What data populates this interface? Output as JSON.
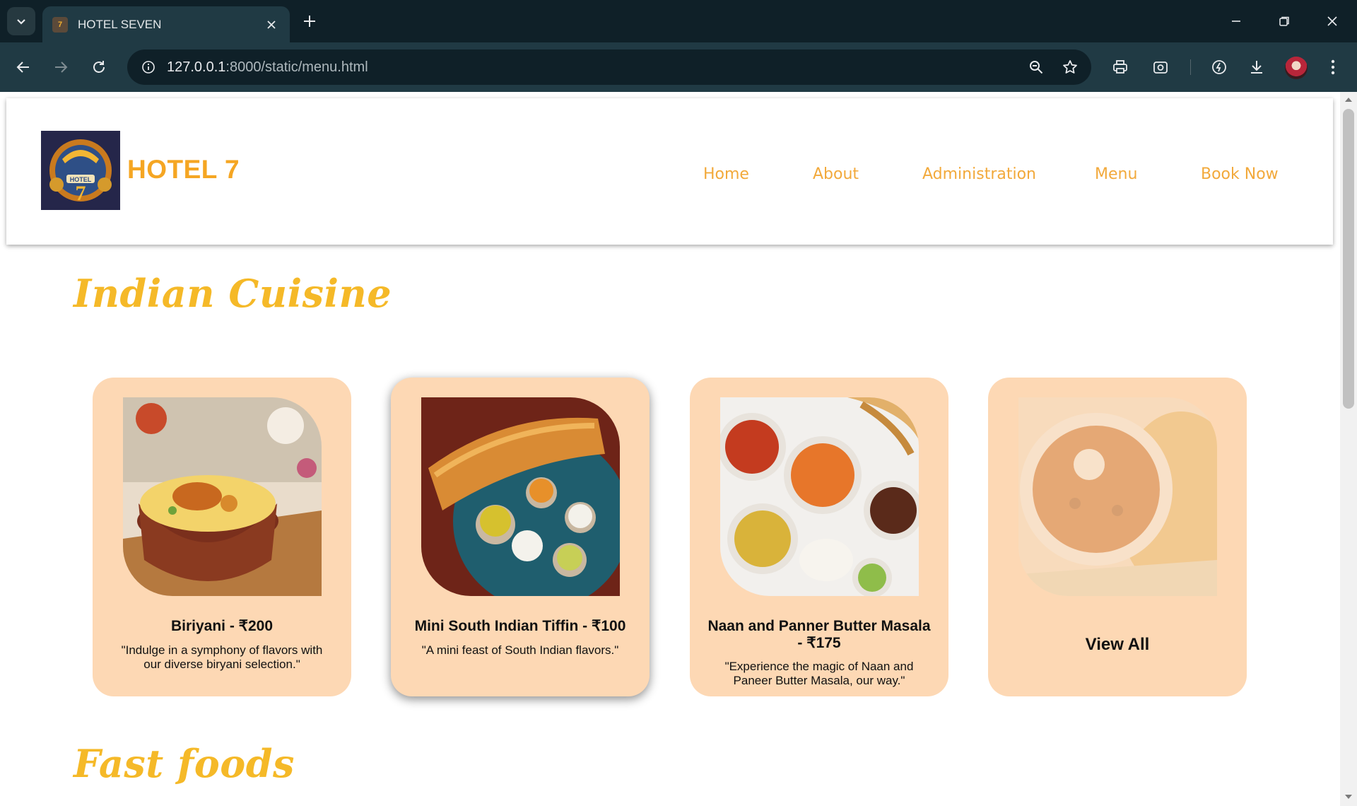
{
  "browser": {
    "tab_title": "HOTEL SEVEN",
    "url_host": "127.0.0.1",
    "url_path": ":8000/static/menu.html"
  },
  "site": {
    "brand": "HOTEL 7",
    "nav": [
      "Home",
      "About",
      "Administration",
      "Menu",
      "Book Now"
    ],
    "accent_color": "#f5a623",
    "card_color": "#fdd8b4"
  },
  "sections": {
    "indian_title": "Indian Cuisine",
    "fast_title": "Fast foods"
  },
  "cards": [
    {
      "name": "Biriyani - ₹200",
      "desc": "\"Indulge in a symphony of flavors with our diverse biryani selection.\""
    },
    {
      "name": "Mini South Indian Tiffin - ₹100",
      "desc": "\"A mini feast of South Indian flavors.\""
    },
    {
      "name": "Naan and Panner Butter Masala - ₹175",
      "desc": "\"Experience the magic of Naan and Paneer Butter Masala, our way.\""
    },
    {
      "name": "View All"
    }
  ]
}
